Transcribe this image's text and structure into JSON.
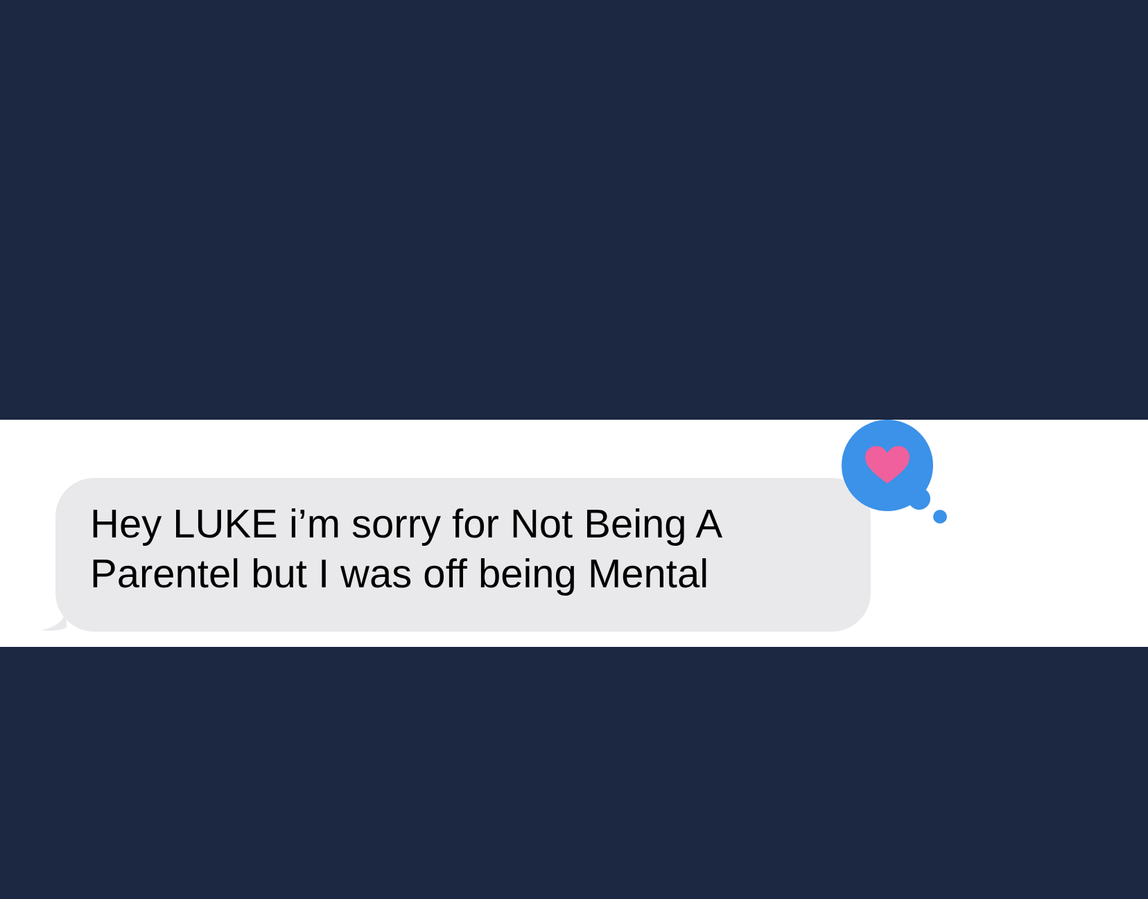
{
  "message": {
    "text": "Hey LUKE i’m sorry for Not Being A Parentel but I was off being Mental"
  },
  "reaction": {
    "kind": "heart"
  }
}
